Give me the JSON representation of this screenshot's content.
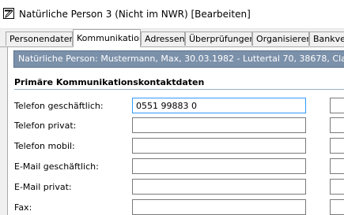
{
  "window": {
    "title": "Natürliche Person 3 (Nicht im NWR) [Bearbeiten]"
  },
  "tabs": [
    {
      "label": "Personendaten"
    },
    {
      "label": "Kommunikation"
    },
    {
      "label": "Adressen"
    },
    {
      "label": "Überprüfungen"
    },
    {
      "label": "Organisieren"
    },
    {
      "label": "Bankver"
    }
  ],
  "active_tab": "Kommunikation",
  "person_bar": {
    "text": "Natürliche Person: Mustermann, Max, 30.03.1982 - Luttertal 70, 38678, Clausthal-Zel"
  },
  "section": {
    "title": "Primäre Kommunikationskontaktdaten"
  },
  "form": {
    "rows": [
      {
        "label": "Telefon geschäftlich:",
        "value": "0551 99883 0"
      },
      {
        "label": "Telefon privat:",
        "value": ""
      },
      {
        "label": "Telefon mobil:",
        "value": ""
      },
      {
        "label": "E-Mail geschäftlich:",
        "value": ""
      },
      {
        "label": "E-Mail privat:",
        "value": ""
      },
      {
        "label": "Fax:",
        "value": ""
      }
    ]
  },
  "colors": {
    "person_bar_bg": "#7b90a9",
    "focus_border": "#3399ff"
  }
}
